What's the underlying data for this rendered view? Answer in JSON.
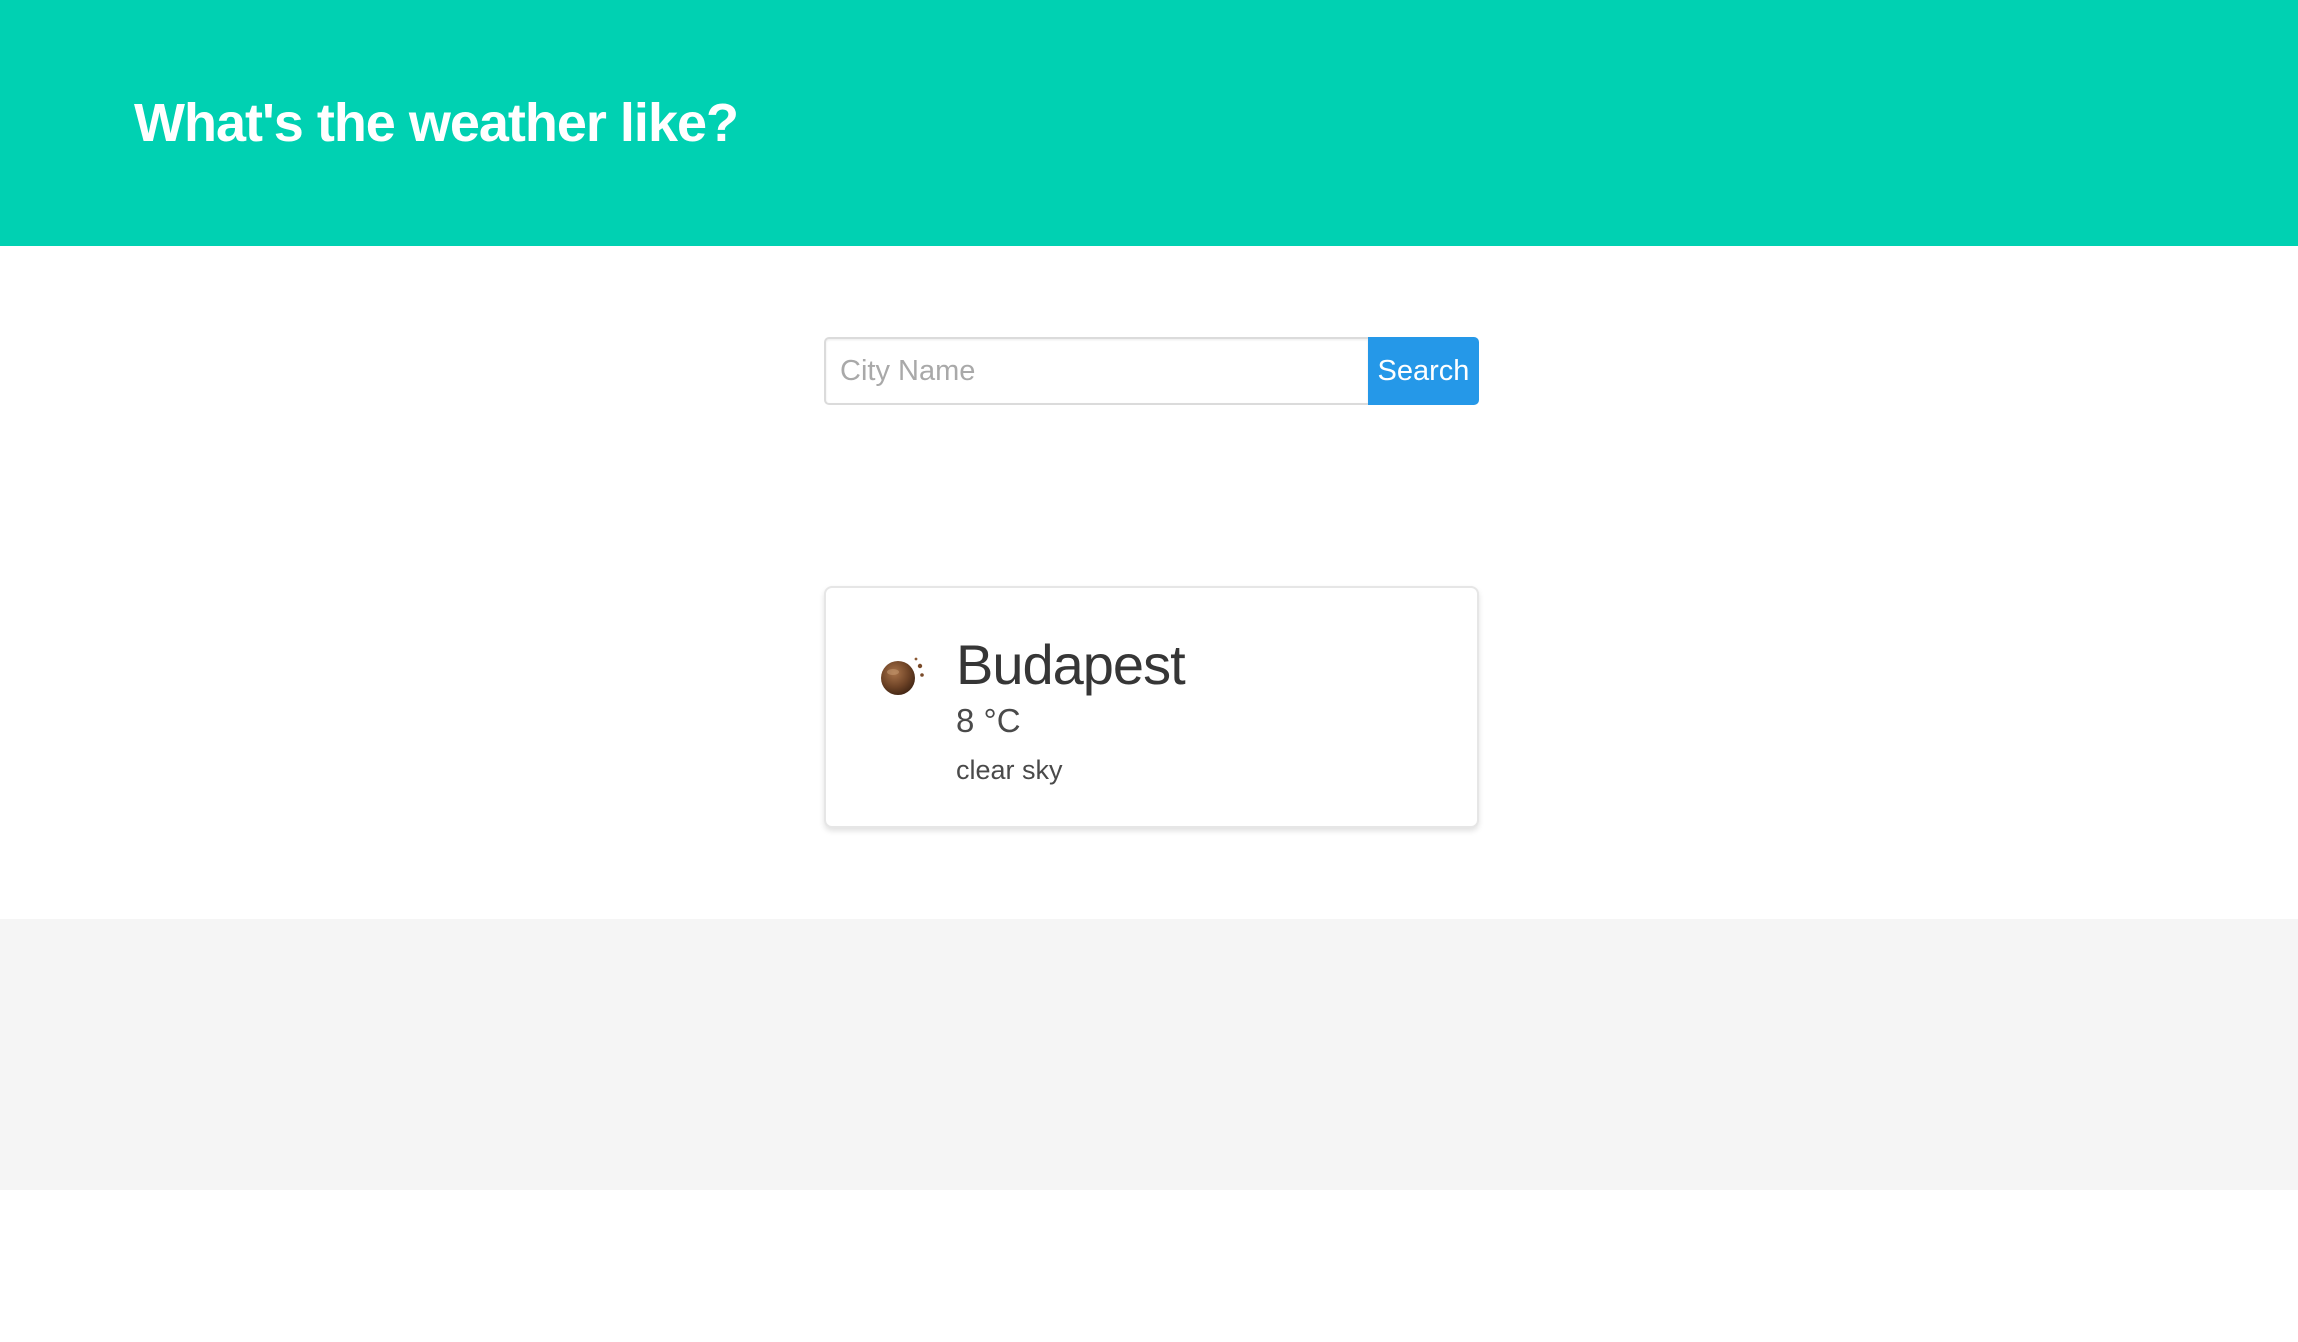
{
  "header": {
    "title": "What's the weather like?",
    "background_color": "#00d1b2"
  },
  "search": {
    "placeholder": "City Name",
    "value": "",
    "button_label": "Search",
    "button_color": "#2598e8"
  },
  "weather": {
    "city": "Budapest",
    "temperature": "8 °C",
    "description": "clear sky",
    "icon": "clear-sky-night-icon"
  },
  "footer": {
    "background_color": "#f5f5f5"
  }
}
